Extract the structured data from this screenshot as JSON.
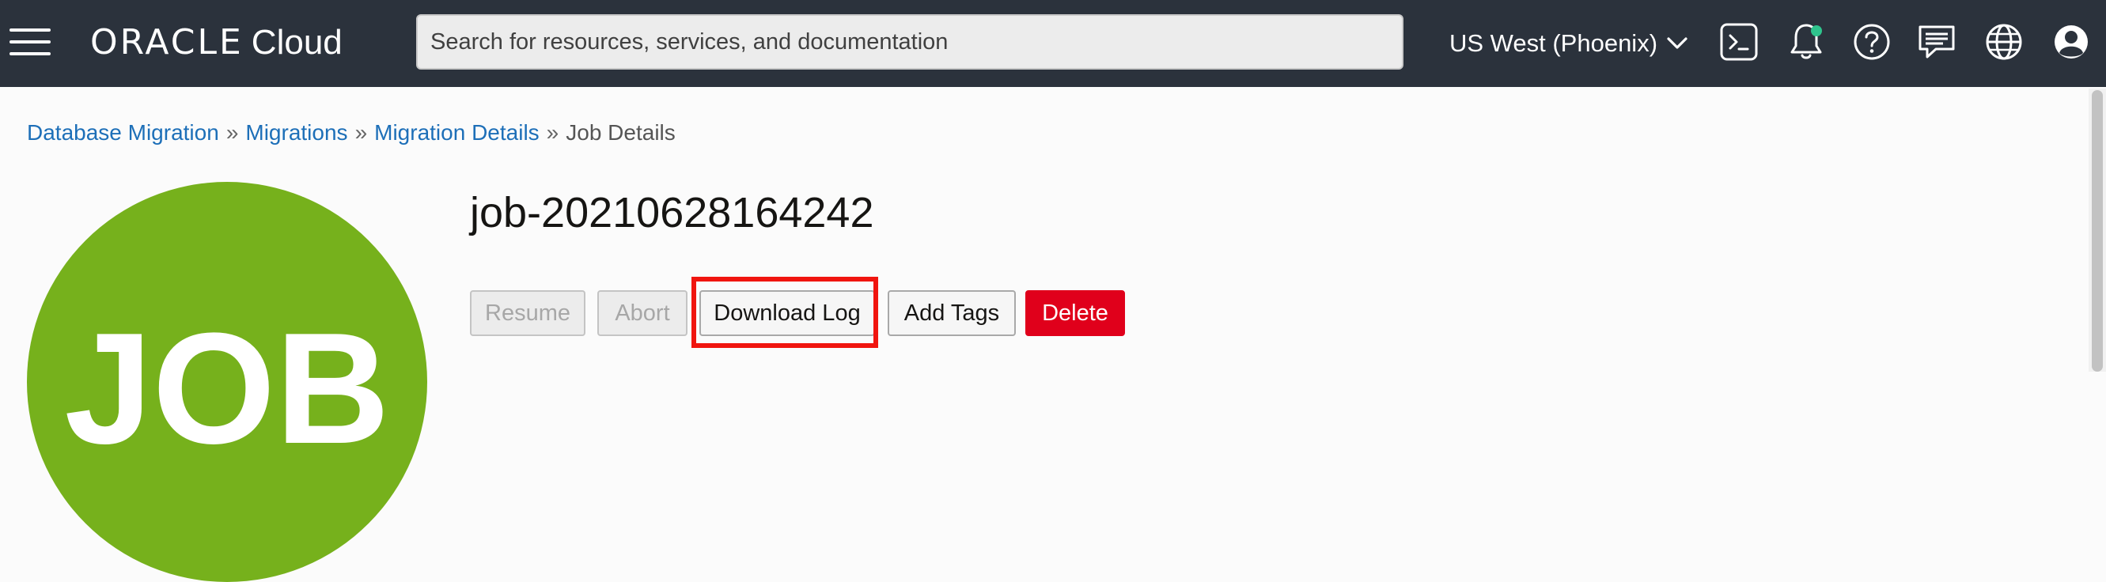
{
  "topbar": {
    "logo_brand": "ORACLE",
    "logo_product": "Cloud",
    "search_placeholder": "Search for resources, services, and documentation",
    "region": "US West (Phoenix)",
    "icons": [
      "menu-icon",
      "cloud-shell-icon",
      "notifications-icon",
      "help-icon",
      "feedback-icon",
      "language-icon",
      "profile-icon"
    ],
    "colors": {
      "background": "#2b323c",
      "notification_dot": "#2fc48d"
    }
  },
  "breadcrumb": {
    "items": [
      "Database Migration",
      "Migrations",
      "Migration Details"
    ],
    "current": "Job Details",
    "separator": "»"
  },
  "avatar": {
    "text": "JOB",
    "color": "#76b11c"
  },
  "page": {
    "title": "job-20210628164242"
  },
  "actions": {
    "resume": "Resume",
    "abort": "Abort",
    "download_log": "Download Log",
    "add_tags": "Add Tags",
    "delete": "Delete"
  },
  "colors": {
    "link": "#1d6fb8",
    "danger": "#e0001b",
    "highlight": "#f0150f"
  }
}
